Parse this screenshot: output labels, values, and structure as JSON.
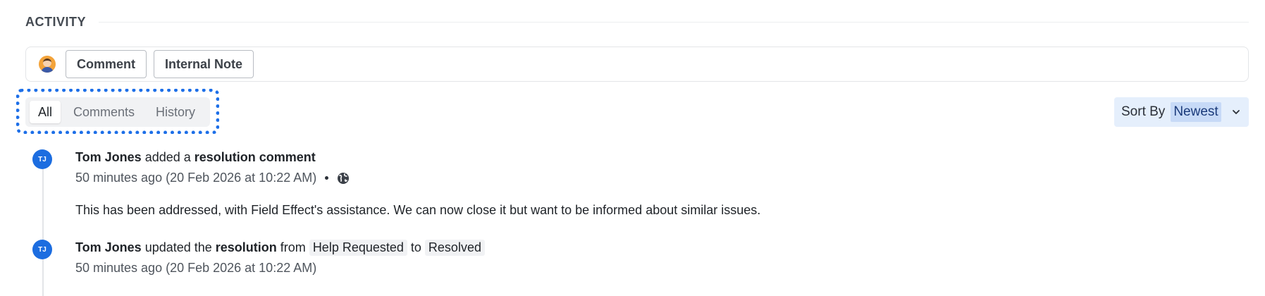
{
  "header": {
    "title": "ACTIVITY"
  },
  "composer": {
    "avatar_icon": "user-avatar-icon",
    "comment_label": "Comment",
    "internal_note_label": "Internal Note"
  },
  "filter_tabs": [
    {
      "label": "All",
      "active": true
    },
    {
      "label": "Comments",
      "active": false
    },
    {
      "label": "History",
      "active": false
    }
  ],
  "sort": {
    "label": "Sort By",
    "value": "Newest",
    "icon": "chevron-down-icon"
  },
  "entries": [
    {
      "initials": "TJ",
      "actor": "Tom Jones",
      "action": " added a ",
      "object": "resolution comment",
      "time": "50 minutes ago (20 Feb 2026 at 10:22 AM)",
      "visibility_icon": "globe-icon",
      "body": "This has been addressed, with Field Effect's assistance. We can now close it but want to be informed about similar issues."
    },
    {
      "initials": "TJ",
      "actor": "Tom Jones",
      "action": " updated the ",
      "object": "resolution",
      "from_word": " from ",
      "from_value": "Help Requested",
      "to_word": " to ",
      "to_value": "Resolved",
      "time": "50 minutes ago (20 Feb 2026 at 10:22 AM)"
    }
  ],
  "colors": {
    "accent": "#1c6de0",
    "focus_ring": "#1d6fe8",
    "sort_bg": "#e5effc",
    "sort_value_bg": "#c7daf7"
  }
}
